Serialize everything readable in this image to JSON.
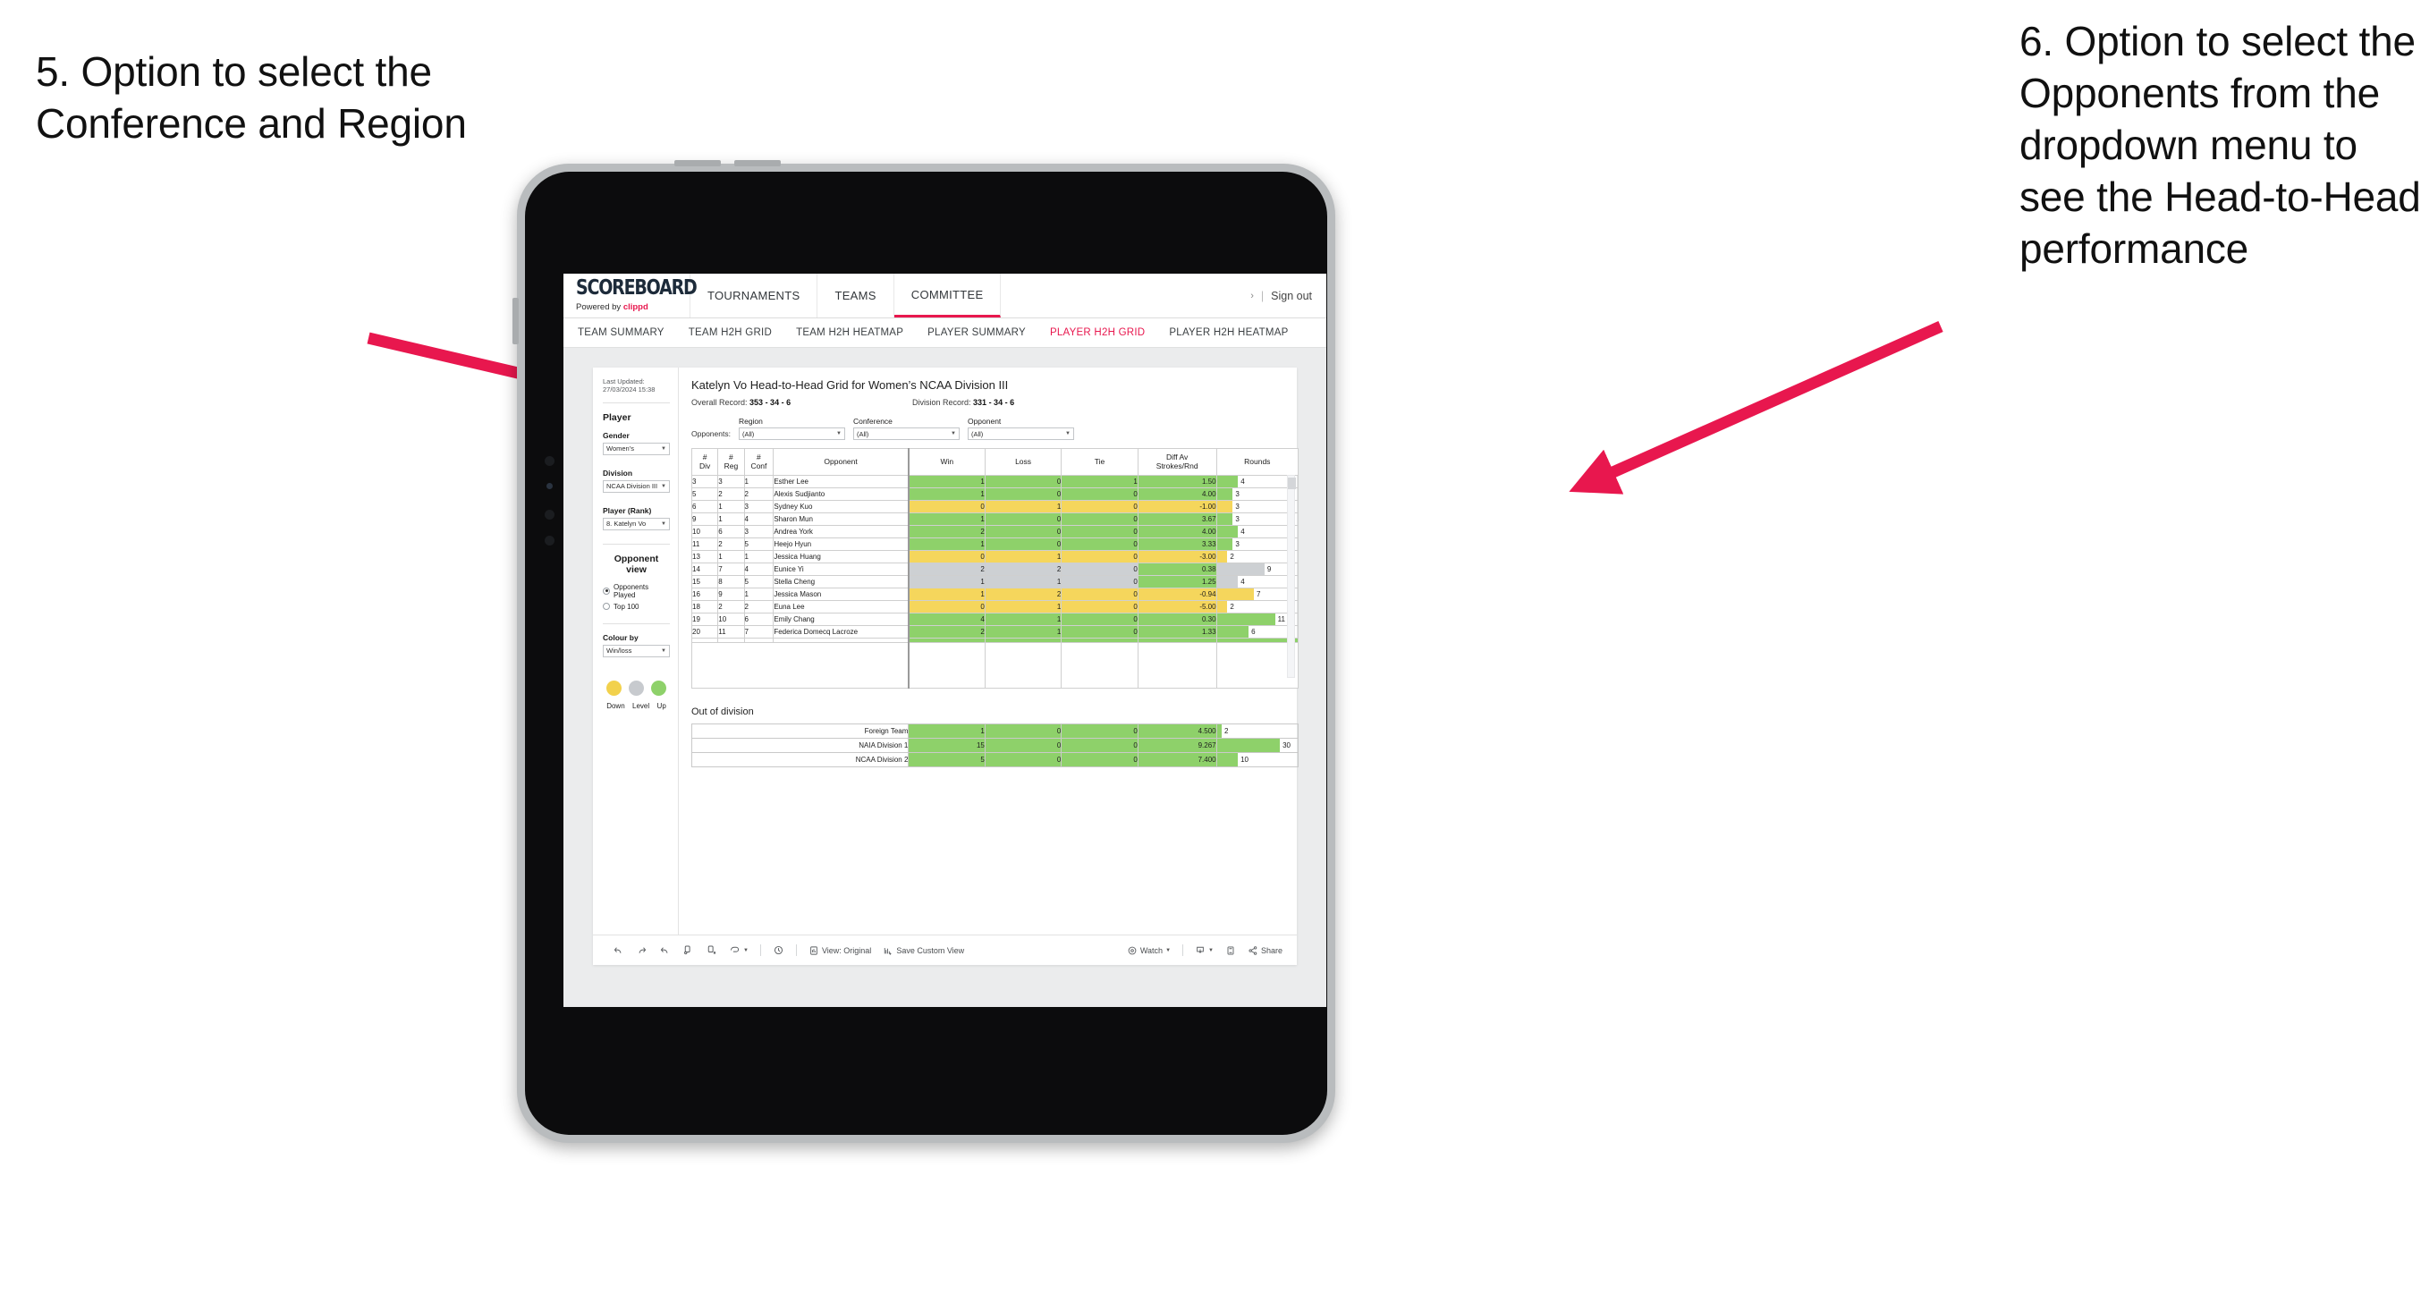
{
  "annotations": {
    "left": "5. Option to select the Conference and Region",
    "right": "6. Option to select the Opponents from the dropdown menu to see the Head-to-Head performance",
    "arrow_color": "#e8174e"
  },
  "topnav": {
    "brand_word": "SCOREBOARD",
    "brand_powered": "Powered by",
    "brand_name": "clippd",
    "items": [
      {
        "label": "TOURNAMENTS",
        "active": false
      },
      {
        "label": "TEAMS",
        "active": false
      },
      {
        "label": "COMMITTEE",
        "active": true
      }
    ],
    "chevron": "›",
    "divider": "|",
    "sign_out": "Sign out"
  },
  "subnav": {
    "items": [
      {
        "label": "TEAM SUMMARY",
        "active": false
      },
      {
        "label": "TEAM H2H GRID",
        "active": false
      },
      {
        "label": "TEAM H2H HEATMAP",
        "active": false
      },
      {
        "label": "PLAYER SUMMARY",
        "active": false
      },
      {
        "label": "PLAYER H2H GRID",
        "active": true
      },
      {
        "label": "PLAYER H2H HEATMAP",
        "active": false
      }
    ],
    "active_color": "#e8174e"
  },
  "sidebar": {
    "last_updated": "Last Updated: 27/03/2024 15:38",
    "player_heading": "Player",
    "gender": {
      "label": "Gender",
      "value": "Women’s"
    },
    "division": {
      "label": "Division",
      "value": "NCAA Division III"
    },
    "player_rank": {
      "label": "Player (Rank)",
      "value": "8. Katelyn Vo"
    },
    "opponent_view": {
      "heading": "Opponent view",
      "options": [
        {
          "label": "Opponents Played",
          "selected": true
        },
        {
          "label": "Top 100",
          "selected": false
        }
      ]
    },
    "colour_by": {
      "label": "Colour by",
      "value": "Win/loss"
    },
    "legend": [
      {
        "label": "Down",
        "color": "#f2d14c"
      },
      {
        "label": "Level",
        "color": "#c7cace"
      },
      {
        "label": "Up",
        "color": "#8ed16a"
      }
    ]
  },
  "main": {
    "title": "Katelyn Vo Head-to-Head Grid for Women’s NCAA Division III",
    "overall_record_label": "Overall Record:",
    "overall_record_value": "353 - 34 - 6",
    "division_record_label": "Division Record:",
    "division_record_value": "331 -  34 - 6",
    "filters": {
      "lead_label": "Opponents:",
      "groups": [
        {
          "label": "Region",
          "value": "(All)"
        },
        {
          "label": "Conference",
          "value": "(All)"
        },
        {
          "label": "Opponent",
          "value": "(All)"
        }
      ]
    }
  },
  "chart_data": {
    "type": "table",
    "title": "Katelyn Vo Head-to-Head Grid for Women’s NCAA Division III",
    "columns": [
      "# Div",
      "# Reg",
      "# Conf",
      "Opponent",
      "Win",
      "Loss",
      "Tie",
      "Diff Av Strokes/Rnd",
      "Rounds"
    ],
    "colour_by": "Win/loss",
    "status_colors": {
      "up": "#8ed16a",
      "down": "#f5d65c",
      "level": "#cdd0d3"
    },
    "rounds_max": 11,
    "rows": [
      {
        "div": "3",
        "reg": "3",
        "conf": "1",
        "opponent": "Esther Lee",
        "win": 1,
        "loss": 0,
        "tie": 1,
        "diff": "1.50",
        "rounds": 4,
        "status": "up"
      },
      {
        "div": "5",
        "reg": "2",
        "conf": "2",
        "opponent": "Alexis Sudjianto",
        "win": 1,
        "loss": 0,
        "tie": 0,
        "diff": "4.00",
        "rounds": 3,
        "status": "up"
      },
      {
        "div": "6",
        "reg": "1",
        "conf": "3",
        "opponent": "Sydney Kuo",
        "win": 0,
        "loss": 1,
        "tie": 0,
        "diff": "-1.00",
        "rounds": 3,
        "status": "down"
      },
      {
        "div": "9",
        "reg": "1",
        "conf": "4",
        "opponent": "Sharon Mun",
        "win": 1,
        "loss": 0,
        "tie": 0,
        "diff": "3.67",
        "rounds": 3,
        "status": "up"
      },
      {
        "div": "10",
        "reg": "6",
        "conf": "3",
        "opponent": "Andrea York",
        "win": 2,
        "loss": 0,
        "tie": 0,
        "diff": "4.00",
        "rounds": 4,
        "status": "up"
      },
      {
        "div": "11",
        "reg": "2",
        "conf": "5",
        "opponent": "Heejo Hyun",
        "win": 1,
        "loss": 0,
        "tie": 0,
        "diff": "3.33",
        "rounds": 3,
        "status": "up"
      },
      {
        "div": "13",
        "reg": "1",
        "conf": "1",
        "opponent": "Jessica Huang",
        "win": 0,
        "loss": 1,
        "tie": 0,
        "diff": "-3.00",
        "rounds": 2,
        "status": "down"
      },
      {
        "div": "14",
        "reg": "7",
        "conf": "4",
        "opponent": "Eunice Yi",
        "win": 2,
        "loss": 2,
        "tie": 0,
        "diff": "0.38",
        "rounds": 9,
        "status": "level",
        "diff_status": "up"
      },
      {
        "div": "15",
        "reg": "8",
        "conf": "5",
        "opponent": "Stella Cheng",
        "win": 1,
        "loss": 1,
        "tie": 0,
        "diff": "1.25",
        "rounds": 4,
        "status": "level",
        "diff_status": "up"
      },
      {
        "div": "16",
        "reg": "9",
        "conf": "1",
        "opponent": "Jessica Mason",
        "win": 1,
        "loss": 2,
        "tie": 0,
        "diff": "-0.94",
        "rounds": 7,
        "status": "down"
      },
      {
        "div": "18",
        "reg": "2",
        "conf": "2",
        "opponent": "Euna Lee",
        "win": 0,
        "loss": 1,
        "tie": 0,
        "diff": "-5.00",
        "rounds": 2,
        "status": "down"
      },
      {
        "div": "19",
        "reg": "10",
        "conf": "6",
        "opponent": "Emily Chang",
        "win": 4,
        "loss": 1,
        "tie": 0,
        "diff": "0.30",
        "rounds": 11,
        "status": "up"
      },
      {
        "div": "20",
        "reg": "11",
        "conf": "7",
        "opponent": "Federica Domecq Lacroze",
        "win": 2,
        "loss": 1,
        "tie": 0,
        "diff": "1.33",
        "rounds": 6,
        "status": "up"
      }
    ],
    "out_of_division": {
      "title": "Out of division",
      "rounds_max": 30,
      "rows": [
        {
          "name": "Foreign Team",
          "win": 1,
          "loss": 0,
          "tie": 0,
          "diff": "4.500",
          "rounds": 2,
          "status": "up"
        },
        {
          "name": "NAIA Division 1",
          "win": 15,
          "loss": 0,
          "tie": 0,
          "diff": "9.267",
          "rounds": 30,
          "status": "up"
        },
        {
          "name": "NCAA Division 2",
          "win": 5,
          "loss": 0,
          "tie": 0,
          "diff": "7.400",
          "rounds": 10,
          "status": "up"
        }
      ]
    }
  },
  "toolbar": {
    "left_icons": [
      "undo-icon",
      "redo-icon",
      "revert-icon",
      "refresh-icon",
      "pause-icon",
      "loop-icon"
    ],
    "view_label": "View: Original",
    "save_label": "Save Custom View",
    "watch_label": "Watch",
    "share_label": "Share",
    "download_icon": "download-icon",
    "fullscreen_icon": "fullscreen-icon"
  }
}
